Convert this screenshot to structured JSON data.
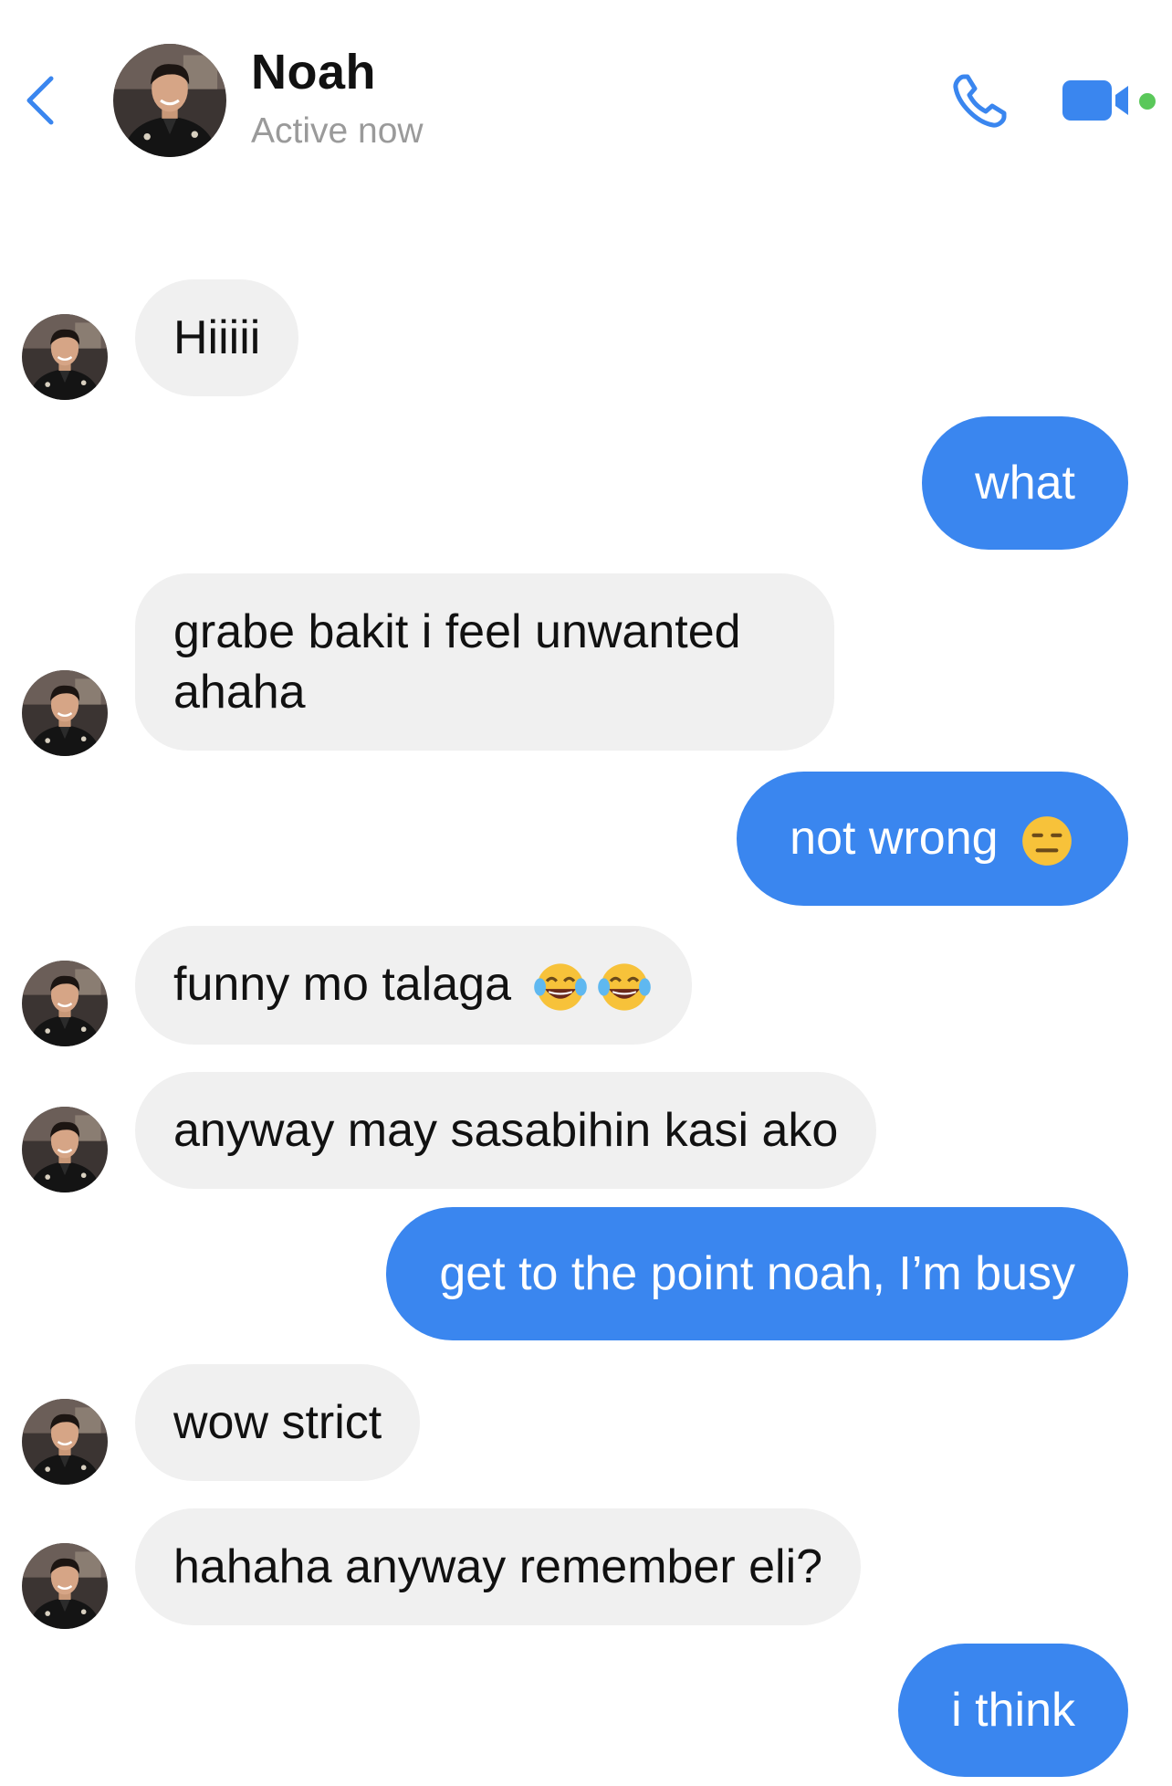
{
  "header": {
    "contact_name": "Noah",
    "status": "Active now"
  },
  "icons": {
    "back": "chevron-left-icon",
    "call": "phone-icon",
    "video": "video-camera-icon"
  },
  "colors": {
    "accent": "#3a86ef",
    "incoming_bubble": "#f0f0f0",
    "online": "#5ac85a"
  },
  "messages": [
    {
      "from": "Noah",
      "text": "Hiiiii"
    },
    {
      "from": "me",
      "text": "what"
    },
    {
      "from": "Noah",
      "text": "grabe bakit i feel unwanted ahaha"
    },
    {
      "from": "me",
      "text": "not wrong",
      "emoji": "expressionless-face"
    },
    {
      "from": "Noah",
      "text": "funny mo talaga",
      "emoji": "tears-of-joy x2"
    },
    {
      "from": "Noah",
      "text": "anyway may sasabihin kasi ako"
    },
    {
      "from": "me",
      "text": "get to the point noah, I’m busy"
    },
    {
      "from": "Noah",
      "text": "wow strict"
    },
    {
      "from": "Noah",
      "text": "hahaha anyway remember eli?"
    },
    {
      "from": "me",
      "text": "i think"
    }
  ]
}
